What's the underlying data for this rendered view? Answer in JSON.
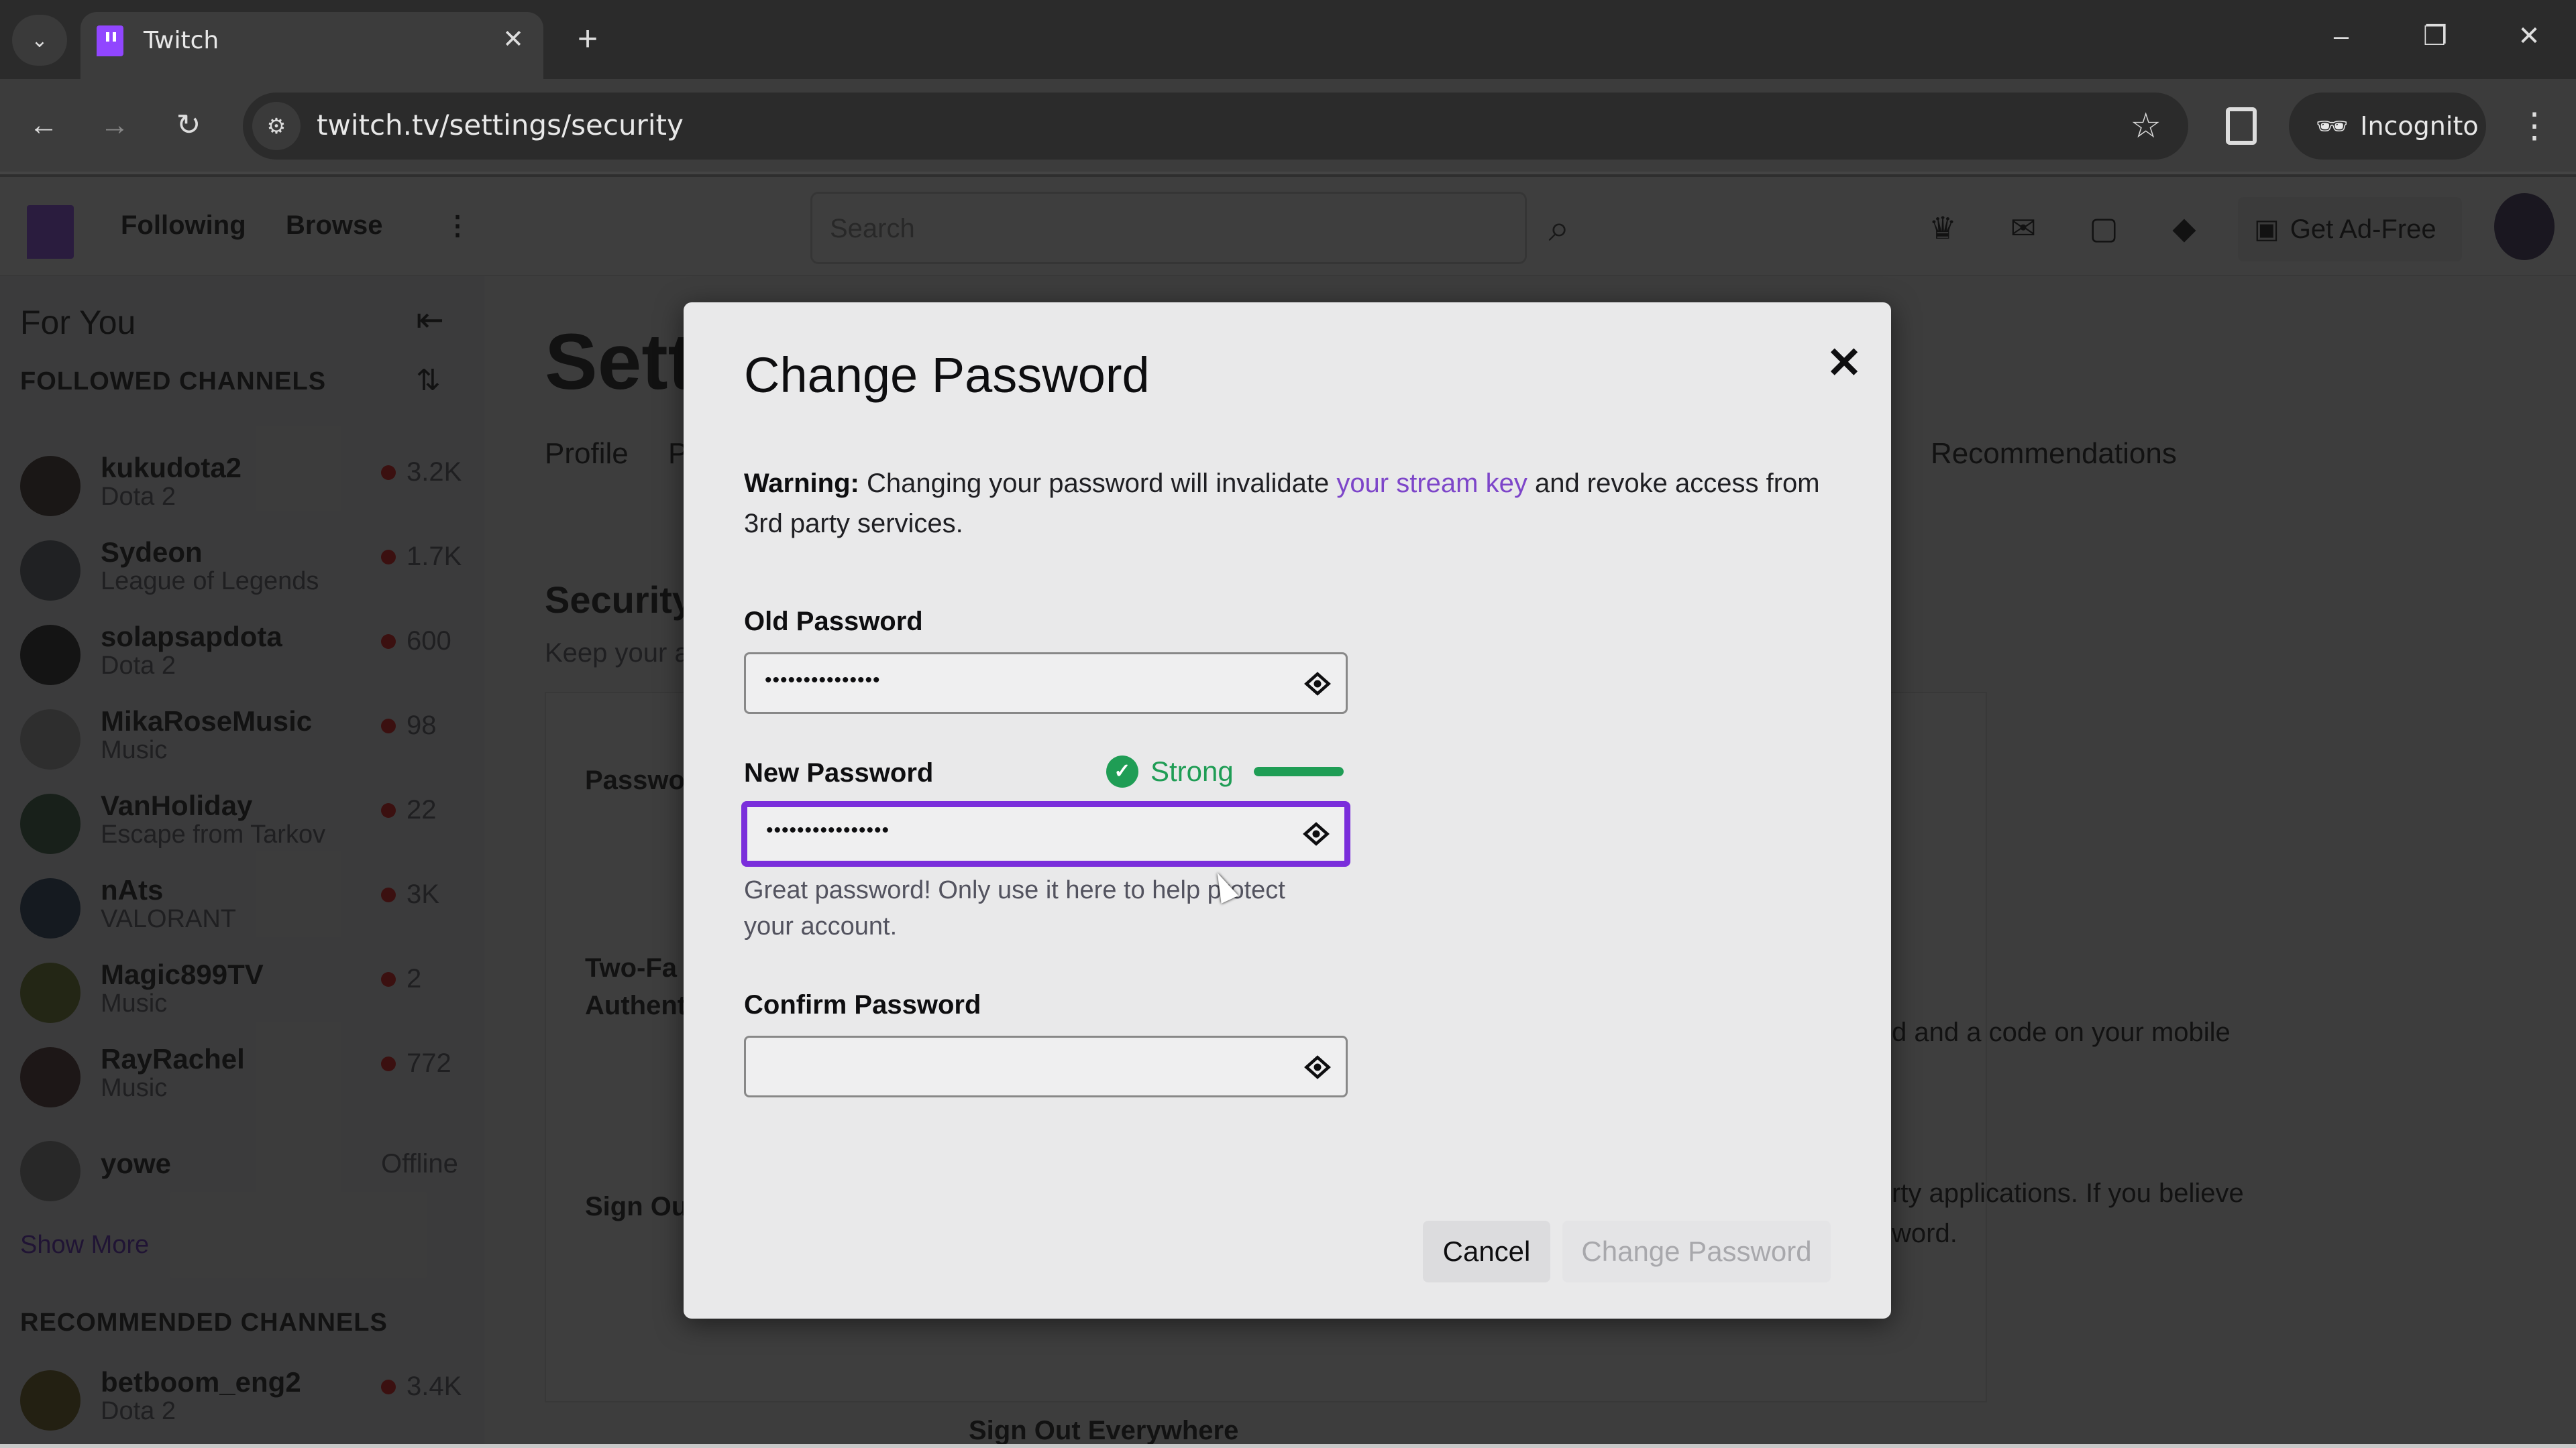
{
  "browser": {
    "tab_title": "Twitch",
    "url": "twitch.tv/settings/security",
    "incognito_label": "Incognito",
    "icons": {
      "tab_list": "chevron-down-icon",
      "tab_close": "close-icon",
      "new_tab": "plus-icon",
      "back": "arrow-left-icon",
      "forward": "arrow-right-icon",
      "reload": "reload-icon",
      "site_info": "tune-icon",
      "bookmark": "star-icon",
      "side_panel": "side-panel-icon",
      "menu": "kebab-icon"
    },
    "window_controls": [
      "minimize",
      "restore",
      "close"
    ]
  },
  "twitch_nav": {
    "following": "Following",
    "browse": "Browse",
    "search_placeholder": "Search",
    "get_ad_free": "Get Ad-Free",
    "icons": [
      "crown-icon",
      "inbox-icon",
      "whispers-icon",
      "bits-icon"
    ]
  },
  "sidebar": {
    "title": "For You",
    "followed_heading": "FOLLOWED CHANNELS",
    "followed": [
      {
        "name": "kukudota2",
        "game": "Dota 2",
        "viewers": "3.2K",
        "live": true
      },
      {
        "name": "Sydeon",
        "game": "League of Legends",
        "viewers": "1.7K",
        "live": true
      },
      {
        "name": "solapsapdota",
        "game": "Dota 2",
        "viewers": "600",
        "live": true
      },
      {
        "name": "MikaRoseMusic",
        "game": "Music",
        "viewers": "98",
        "live": true
      },
      {
        "name": "VanHoliday",
        "game": "Escape from Tarkov",
        "viewers": "22",
        "live": true
      },
      {
        "name": "nAts",
        "game": "VALORANT",
        "viewers": "3K",
        "live": true
      },
      {
        "name": "Magic899TV",
        "game": "Music",
        "viewers": "2",
        "live": true
      },
      {
        "name": "RayRachel",
        "game": "Music",
        "viewers": "772",
        "live": true
      },
      {
        "name": "yowe",
        "game": "",
        "viewers": "Offline",
        "live": false
      }
    ],
    "show_more": "Show More",
    "recommended_heading": "RECOMMENDED CHANNELS",
    "recommended": [
      {
        "name": "betboom_eng2",
        "game": "Dota 2",
        "viewers": "3.4K",
        "live": true
      }
    ]
  },
  "settings_page": {
    "title": "Settings",
    "tabs": [
      "Profile",
      "P",
      "Recommendations"
    ],
    "section_title": "Security",
    "section_desc": "Keep your a",
    "rows": [
      "Passwo",
      "Two-Fa",
      "Authent",
      "Sign Ou"
    ],
    "fragments": {
      "two_factor_desc": "d and a code on your mobile",
      "signout_desc_1": "rty applications. If you believe",
      "signout_desc_2": "word.",
      "signout_button": "Sign Out Everywhere"
    }
  },
  "modal": {
    "title": "Change Password",
    "warning_bold": "Warning:",
    "warning_text_1": " Changing your password will invalidate ",
    "warning_link": "your stream key",
    "warning_text_2": " and revoke access from 3rd party services.",
    "old_password": {
      "label": "Old Password",
      "value": "•••••••••••••••"
    },
    "new_password": {
      "label": "New Password",
      "value": "••••••••••••••••",
      "strength_label": "Strong",
      "strength_fraction": 1.0
    },
    "new_password_hint": "Great password! Only use it here to help protect your account.",
    "confirm_password": {
      "label": "Confirm Password",
      "value": ""
    },
    "cancel_label": "Cancel",
    "submit_label": "Change Password",
    "colors": {
      "accent": "#7a2edb",
      "link": "#7d45c9",
      "success": "#1f9d55"
    }
  }
}
